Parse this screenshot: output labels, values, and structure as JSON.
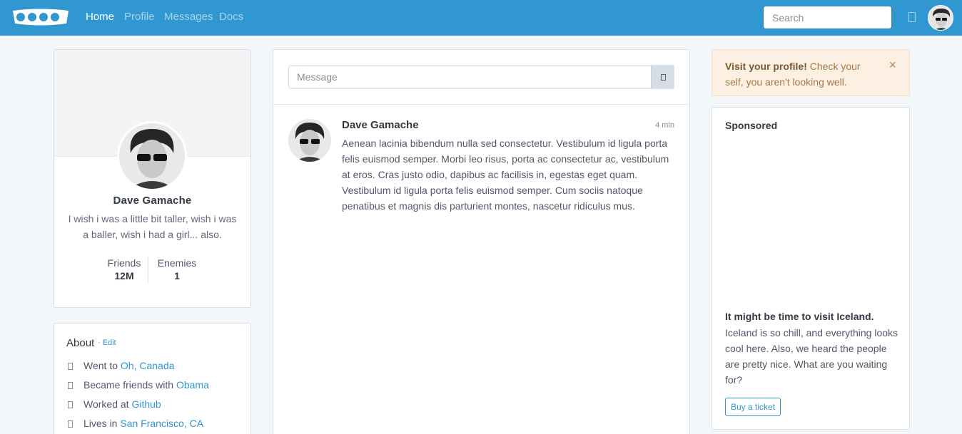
{
  "nav": {
    "links": [
      "Home",
      "Profile",
      "Messages",
      "Docs"
    ],
    "search_placeholder": "Search",
    "brand_icon": "brand-logo-icon",
    "notification_icon": "bell-icon"
  },
  "profile": {
    "name": "Dave Gamache",
    "bio": "I wish i was a little bit taller, wish i was a baller, wish i had a girl... also.",
    "stats": [
      {
        "label": "Friends",
        "value": "12M"
      },
      {
        "label": "Enemies",
        "value": "1"
      }
    ]
  },
  "about": {
    "title": "About",
    "separator": "·",
    "edit_label": "Edit",
    "items": [
      {
        "text": "Went to ",
        "link": "Oh, Canada"
      },
      {
        "text": "Became friends with ",
        "link": "Obama"
      },
      {
        "text": "Worked at ",
        "link": "Github"
      },
      {
        "text": "Lives in ",
        "link": "San Francisco, CA"
      }
    ]
  },
  "composer": {
    "placeholder": "Message",
    "button_icon": "camera-icon"
  },
  "post": {
    "author": "Dave Gamache",
    "time": "4 min",
    "body": "Aenean lacinia bibendum nulla sed consectetur. Vestibulum id ligula porta felis euismod semper. Morbi leo risus, porta ac consectetur ac, vestibulum at eros. Cras justo odio, dapibus ac facilisis in, egestas eget quam. Vestibulum id ligula porta felis euismod semper. Cum sociis natoque penatibus et magnis dis parturient montes, nascetur ridiculus mus."
  },
  "alert": {
    "strong": "Visit your profile!",
    "text": " Check your self, you aren't looking well.",
    "close": "×"
  },
  "sponsored": {
    "title": "Sponsored",
    "heading": "It might be time to visit Iceland.",
    "text": "Iceland is so chill, and everything looks cool here. Also, we heard the people are pretty nice. What are you waiting for?",
    "button": "Buy a ticket"
  },
  "colors": {
    "navbar": "#3097d1",
    "background": "#f4f7fa",
    "alert_bg": "#fcf0e2",
    "link": "#3097d1"
  }
}
